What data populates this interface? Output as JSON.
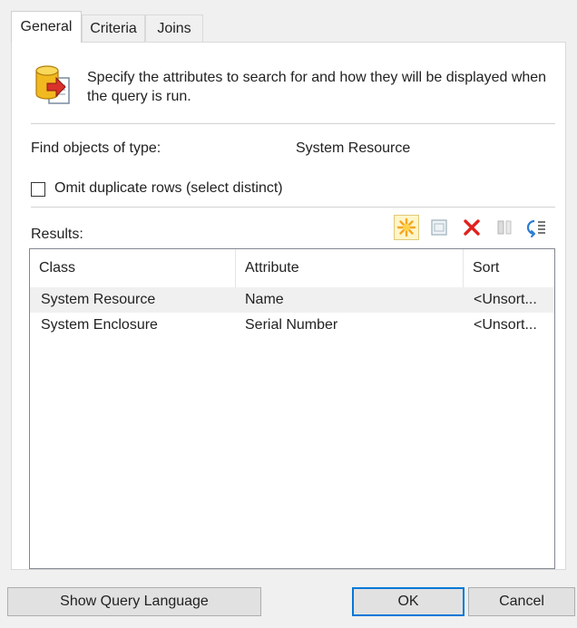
{
  "tabs": [
    {
      "label": "General",
      "active": true
    },
    {
      "label": "Criteria",
      "active": false
    },
    {
      "label": "Joins",
      "active": false
    }
  ],
  "general": {
    "icon": "database-query-icon",
    "description": "Specify the attributes to search for and how they will be displayed when the query is run.",
    "find_label": "Find objects of type:",
    "find_value": "System Resource",
    "omit_label": "Omit duplicate rows (select distinct)",
    "omit_checked": false
  },
  "results": {
    "label": "Results:",
    "toolbar": [
      {
        "icon": "new-sparkle-icon",
        "enabled": true
      },
      {
        "icon": "properties-icon",
        "enabled": false
      },
      {
        "icon": "delete-x-icon",
        "enabled": true
      },
      {
        "icon": "move-icon",
        "enabled": false
      },
      {
        "icon": "list-order-icon",
        "enabled": true
      }
    ],
    "columns": [
      "Class",
      "Attribute",
      "Sort"
    ],
    "rows": [
      {
        "class": "System Resource",
        "attribute": "Name",
        "sort": "<Unsort..."
      },
      {
        "class": "System Enclosure",
        "attribute": "Serial Number",
        "sort": "<Unsort..."
      }
    ]
  },
  "buttons": {
    "show_query": "Show Query Language",
    "ok": "OK",
    "cancel": "Cancel"
  },
  "colors": {
    "accent": "#0078d7",
    "delete": "#e0211c",
    "sparkle": "#f5a623",
    "db_gold": "#f1b91f"
  }
}
